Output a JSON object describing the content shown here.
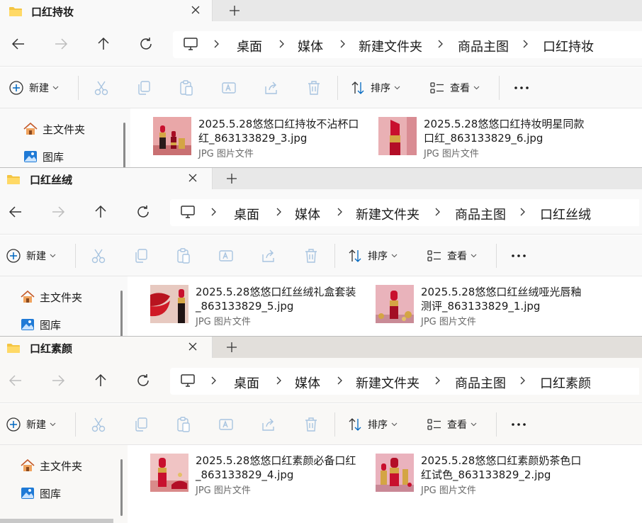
{
  "toolbar": {
    "new_label": "新建",
    "sort_label": "排序",
    "view_label": "查看",
    "more_label": "•••"
  },
  "sidebar": {
    "items": [
      {
        "label": "主文件夹",
        "icon": "home-icon"
      },
      {
        "label": "图库",
        "icon": "gallery-icon"
      }
    ]
  },
  "breadcrumb": [
    "桌面",
    "媒体",
    "新建文件夹",
    "商品主图"
  ],
  "windows": [
    {
      "tab_title": "口红持妆",
      "current_folder": "口红持妆",
      "files": [
        {
          "name": "2025.5.28悠悠口红持妆不沾杯口\n红_863133829_3.jpg",
          "type": "JPG 图片文件"
        },
        {
          "name": "2025.5.28悠悠口红持妆明星同款\n口红_863133829_6.jpg",
          "type": "JPG 图片文件"
        }
      ]
    },
    {
      "tab_title": "口红丝绒",
      "current_folder": "口红丝绒",
      "files": [
        {
          "name": "2025.5.28悠悠口红丝绒礼盒套装\n_863133829_5.jpg",
          "type": "JPG 图片文件"
        },
        {
          "name": "2025.5.28悠悠口红丝绒哑光唇釉\n测评_863133829_1.jpg",
          "type": "JPG 图片文件"
        }
      ]
    },
    {
      "tab_title": "口红素颜",
      "current_folder": "口红素颜",
      "files": [
        {
          "name": "2025.5.28悠悠口红素颜必备口红\n_863133829_4.jpg",
          "type": "JPG 图片文件"
        },
        {
          "name": "2025.5.28悠悠口红素颜奶茶色口\n红试色_863133829_2.jpg",
          "type": "JPG 图片文件"
        }
      ]
    }
  ],
  "colors": {
    "tab_bg": "#f9f9f9",
    "tabbar_bg": "#e8e8e8",
    "accent_blue": "#0067c0",
    "folder_yellow": "#f4c542",
    "lipstick_red": "#c8102e"
  }
}
